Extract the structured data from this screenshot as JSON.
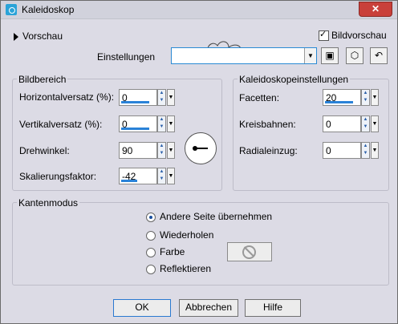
{
  "window": {
    "title": "Kaleidoskop",
    "close_label": "✕"
  },
  "top": {
    "preview_label": "Vorschau",
    "bild_preview_label": "Bildvorschau",
    "bild_preview_checked": true,
    "settings_label": "Einstellungen",
    "settings_value": "",
    "toolbar_icons": [
      "save-icon",
      "cube-icon",
      "reset-icon"
    ]
  },
  "bildbereich": {
    "title": "Bildbereich",
    "fields": [
      {
        "label": "Horizontalversatz (%):",
        "value": "0",
        "level": 0.5
      },
      {
        "label": "Vertikalversatz (%):",
        "value": "0",
        "level": 0.5
      },
      {
        "label": "Drehwinkel:",
        "value": "90",
        "level": 0.0
      },
      {
        "label": "Skalierungsfaktor:",
        "value": "-42",
        "level": 0.29
      }
    ]
  },
  "kaleido": {
    "title": "Kaleidoskopeinstellungen",
    "fields": [
      {
        "label": "Facetten:",
        "value": "20",
        "level": 0.5
      },
      {
        "label": "Kreisbahnen:",
        "value": "0",
        "level": 0.0
      },
      {
        "label": "Radialeinzug:",
        "value": "0",
        "level": 0.0
      }
    ]
  },
  "kanten": {
    "title": "Kantenmodus",
    "options": [
      {
        "label": "Andere Seite übernehmen",
        "selected": true
      },
      {
        "label": "Wiederholen",
        "selected": false
      },
      {
        "label": "Farbe",
        "selected": false
      },
      {
        "label": "Reflektieren",
        "selected": false
      }
    ]
  },
  "buttons": {
    "ok": "OK",
    "cancel": "Abbrechen",
    "help": "Hilfe"
  },
  "colors": {
    "accent": "#2a82d8",
    "close": "#c9403a",
    "background": "#dcdbe5"
  }
}
